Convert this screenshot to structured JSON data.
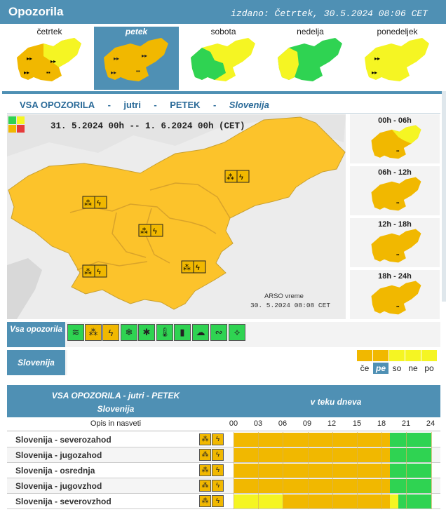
{
  "header": {
    "title": "Opozorila",
    "issued": "izdano: Četrtek, 30.5.2024 08:06 CET"
  },
  "days": [
    {
      "label": "četrtek",
      "active": false
    },
    {
      "label": "petek",
      "active": true
    },
    {
      "label": "sobota",
      "active": false
    },
    {
      "label": "nedelja",
      "active": false
    },
    {
      "label": "ponedeljek",
      "active": false
    }
  ],
  "colors": {
    "orange": "#f1b800",
    "yellow": "#f5f523",
    "green": "#2fd352",
    "blue": "#4f90b4",
    "map_orange": "#fcc32b"
  },
  "main": {
    "bar": [
      "VSA OPOZORILA",
      "-",
      "jutri",
      "-",
      "PETEK",
      "-",
      "Slovenija"
    ],
    "daterange": "31. 5.2024  00h  --  1. 6.2024  00h    (CET)",
    "credit_1": "ARSO vreme",
    "credit_2": "30. 5.2024  08:08 CET"
  },
  "slots": [
    "00h - 06h",
    "06h - 12h",
    "12h - 18h",
    "18h - 24h"
  ],
  "warning_types": {
    "label": "Vsa opozorila",
    "icons": [
      "wind-icon",
      "thunderstorm-rain-icon",
      "lightning-icon",
      "snow-icon",
      "storm-icon",
      "high-temperature-icon",
      "low-temperature-icon",
      "fog-icon",
      "coastal-icon",
      "ice-icon"
    ]
  },
  "region": {
    "label": "Slovenija",
    "strip_labels": [
      "če",
      "pe",
      "so",
      "ne",
      "po"
    ]
  },
  "table": {
    "title": "VSA OPOZORILA - jutri - PETEK",
    "subtitle": "Slovenija",
    "daylabel": "v teku dneva",
    "col": "Opis in nasveti",
    "hours": [
      "00",
      "03",
      "06",
      "09",
      "12",
      "15",
      "18",
      "21",
      "24"
    ],
    "rows": [
      {
        "name": "Slovenija - severozahod",
        "segments": [
          [
            "orange",
            0,
            19
          ],
          [
            "green",
            19,
            24
          ]
        ]
      },
      {
        "name": "Slovenija - jugozahod",
        "segments": [
          [
            "orange",
            0,
            19
          ],
          [
            "green",
            19,
            24
          ]
        ]
      },
      {
        "name": "Slovenija - osrednja",
        "segments": [
          [
            "orange",
            0,
            19
          ],
          [
            "green",
            19,
            24
          ]
        ]
      },
      {
        "name": "Slovenija - jugovzhod",
        "segments": [
          [
            "orange",
            0,
            19
          ],
          [
            "green",
            19,
            24
          ]
        ]
      },
      {
        "name": "Slovenija - severovzhod",
        "segments": [
          [
            "yellow",
            0,
            6
          ],
          [
            "orange",
            6,
            19
          ],
          [
            "yellow",
            19,
            20
          ],
          [
            "green",
            20,
            24
          ]
        ]
      }
    ]
  }
}
